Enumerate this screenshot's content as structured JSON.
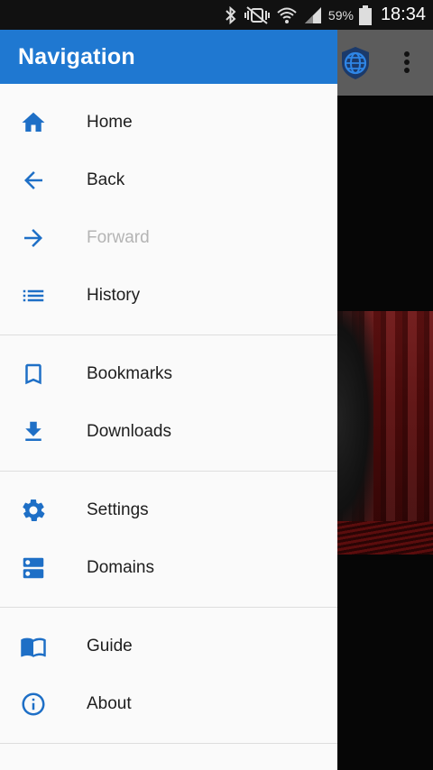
{
  "status_bar": {
    "battery_percent": "59%",
    "time": "18:34",
    "icons": [
      "bluetooth-icon",
      "vibrate-mute-icon",
      "wifi-icon",
      "signal-icon",
      "battery-icon"
    ]
  },
  "background_app": {
    "toolbar_icons": [
      "globe-shield-icon",
      "overflow-menu-icon"
    ]
  },
  "drawer": {
    "title": "Navigation",
    "accent_color": "#1f78d1",
    "groups": [
      {
        "items": [
          {
            "label": "Home",
            "icon": "home-icon",
            "enabled": true
          },
          {
            "label": "Back",
            "icon": "arrow-back-icon",
            "enabled": true
          },
          {
            "label": "Forward",
            "icon": "arrow-forward-icon",
            "enabled": false
          },
          {
            "label": "History",
            "icon": "history-list-icon",
            "enabled": true
          }
        ]
      },
      {
        "items": [
          {
            "label": "Bookmarks",
            "icon": "bookmark-icon",
            "enabled": true
          },
          {
            "label": "Downloads",
            "icon": "download-icon",
            "enabled": true
          }
        ]
      },
      {
        "items": [
          {
            "label": "Settings",
            "icon": "gear-icon",
            "enabled": true
          },
          {
            "label": "Domains",
            "icon": "domains-icon",
            "enabled": true
          }
        ]
      },
      {
        "items": [
          {
            "label": "Guide",
            "icon": "book-icon",
            "enabled": true
          },
          {
            "label": "About",
            "icon": "info-icon",
            "enabled": true
          }
        ]
      }
    ]
  }
}
